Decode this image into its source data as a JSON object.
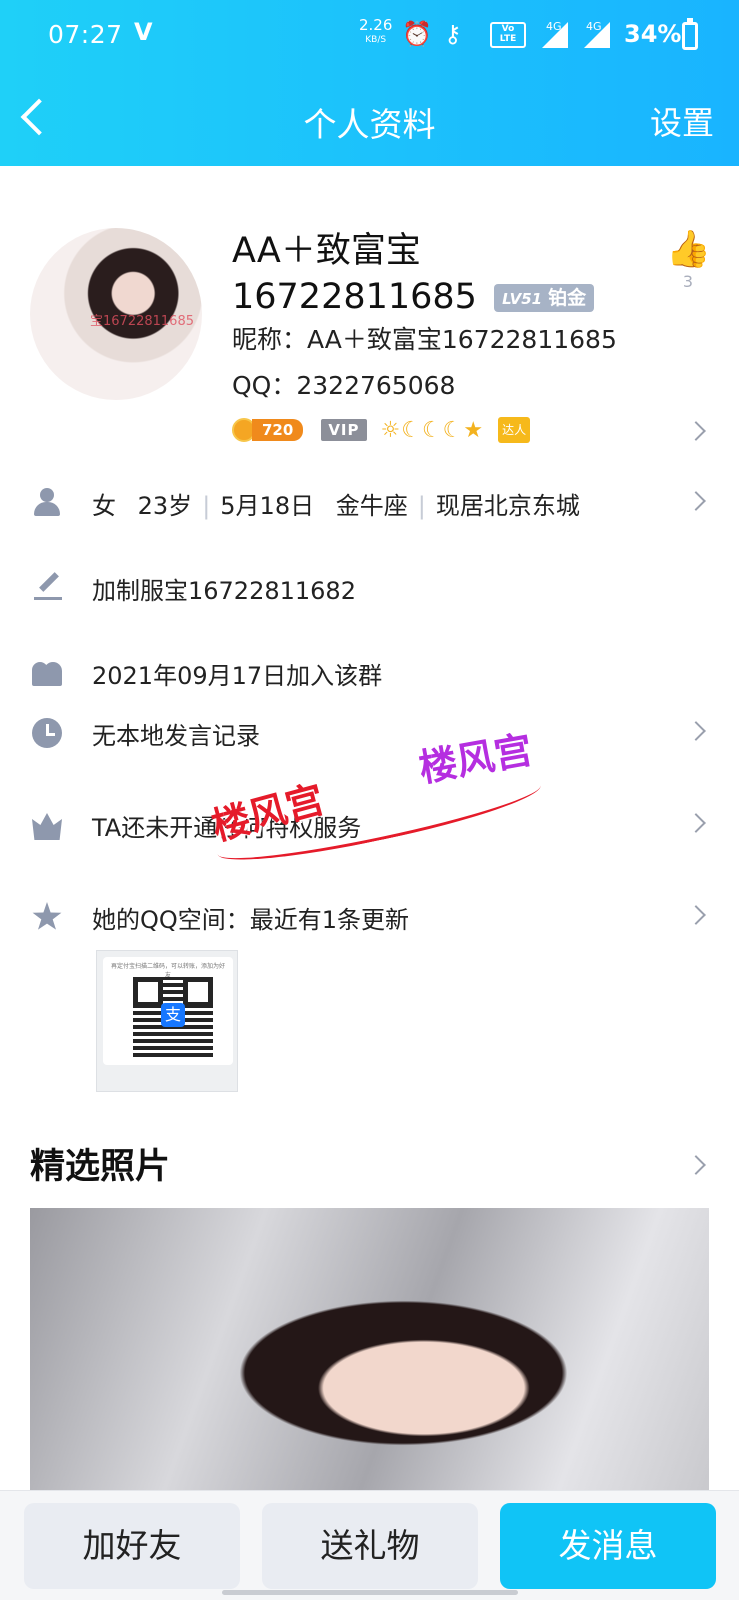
{
  "status_bar": {
    "time": "07:27",
    "v_icon": "V",
    "speed_value": "2.26",
    "speed_unit": "KB/S",
    "lte_label": "Vo LTE",
    "net1": "4G",
    "net2": "4G",
    "battery": "34%",
    "icons": [
      "alarm-icon",
      "key-icon",
      "volte-icon",
      "signal-icon",
      "battery-icon"
    ]
  },
  "header": {
    "title": "个人资料",
    "settings_label": "设置",
    "background": "#19b4ff"
  },
  "profile": {
    "avatar_watermark": "宝16722811685",
    "name": "AA＋致富宝16722811685",
    "level": "LV51",
    "level_tier": "铂金",
    "nickname": "昵称：AA＋致富宝16722811685",
    "qq": "QQ：2322765068",
    "coin_value": "720",
    "vip_label": "VIP",
    "level_icons": "☼☾☾☾★",
    "daren_label": "达人",
    "like_count": "3"
  },
  "info_rows": {
    "basic": {
      "gender": "女",
      "age": "23岁",
      "birthday": "5月18日",
      "zodiac": "金牛座",
      "location": "现居北京东城"
    },
    "signature": "加制服宝16722811682",
    "join_date": "2021年09月17日加入该群",
    "speech_record": "无本地发言记录",
    "service": "TA还未开通任何特权服务",
    "qzone": "她的QQ空间：最近有1条更新"
  },
  "qzone_thumb": {
    "caption": "再定付宝扫描二维码，可以转账，添加为好友"
  },
  "watermark": {
    "text1": "楼风宫",
    "text2": "楼风宫"
  },
  "photos": {
    "section_title": "精选照片"
  },
  "bottom_bar": {
    "add_friend": "加好友",
    "send_gift": "送礼物",
    "send_message": "发消息",
    "primary_color": "#10c4f6"
  }
}
